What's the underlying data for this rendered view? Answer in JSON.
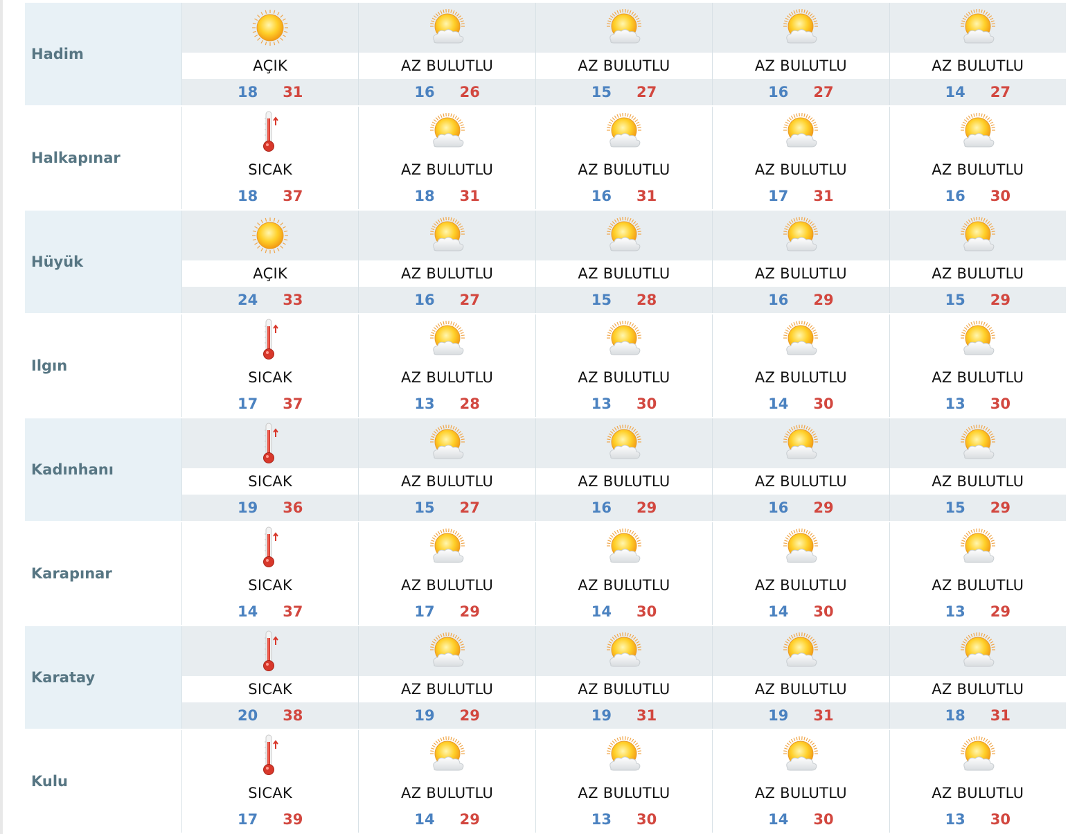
{
  "colors": {
    "low": "#4b82c0",
    "high": "#d2473f",
    "city": "#577683",
    "shade": "#e8f1f6"
  },
  "rows": [
    {
      "city": "Hadim",
      "days": [
        {
          "icon": "sun-icon",
          "desc": "AÇIK",
          "lo": "18",
          "hi": "31"
        },
        {
          "icon": "partly-cloudy-icon",
          "desc": "AZ BULUTLU",
          "lo": "16",
          "hi": "26"
        },
        {
          "icon": "partly-cloudy-icon",
          "desc": "AZ BULUTLU",
          "lo": "15",
          "hi": "27"
        },
        {
          "icon": "partly-cloudy-icon",
          "desc": "AZ BULUTLU",
          "lo": "16",
          "hi": "27"
        },
        {
          "icon": "partly-cloudy-icon",
          "desc": "AZ BULUTLU",
          "lo": "14",
          "hi": "27"
        }
      ]
    },
    {
      "city": "Halkapınar",
      "days": [
        {
          "icon": "thermometer-icon",
          "desc": "SICAK",
          "lo": "18",
          "hi": "37"
        },
        {
          "icon": "partly-cloudy-icon",
          "desc": "AZ BULUTLU",
          "lo": "18",
          "hi": "31"
        },
        {
          "icon": "partly-cloudy-icon",
          "desc": "AZ BULUTLU",
          "lo": "16",
          "hi": "31"
        },
        {
          "icon": "partly-cloudy-icon",
          "desc": "AZ BULUTLU",
          "lo": "17",
          "hi": "31"
        },
        {
          "icon": "partly-cloudy-icon",
          "desc": "AZ BULUTLU",
          "lo": "16",
          "hi": "30"
        }
      ]
    },
    {
      "city": "Hüyük",
      "days": [
        {
          "icon": "sun-icon",
          "desc": "AÇIK",
          "lo": "24",
          "hi": "33"
        },
        {
          "icon": "partly-cloudy-icon",
          "desc": "AZ BULUTLU",
          "lo": "16",
          "hi": "27"
        },
        {
          "icon": "partly-cloudy-icon",
          "desc": "AZ BULUTLU",
          "lo": "15",
          "hi": "28"
        },
        {
          "icon": "partly-cloudy-icon",
          "desc": "AZ BULUTLU",
          "lo": "16",
          "hi": "29"
        },
        {
          "icon": "partly-cloudy-icon",
          "desc": "AZ BULUTLU",
          "lo": "15",
          "hi": "29"
        }
      ]
    },
    {
      "city": "Ilgın",
      "days": [
        {
          "icon": "thermometer-icon",
          "desc": "SICAK",
          "lo": "17",
          "hi": "37"
        },
        {
          "icon": "partly-cloudy-icon",
          "desc": "AZ BULUTLU",
          "lo": "13",
          "hi": "28"
        },
        {
          "icon": "partly-cloudy-icon",
          "desc": "AZ BULUTLU",
          "lo": "13",
          "hi": "30"
        },
        {
          "icon": "partly-cloudy-icon",
          "desc": "AZ BULUTLU",
          "lo": "14",
          "hi": "30"
        },
        {
          "icon": "partly-cloudy-icon",
          "desc": "AZ BULUTLU",
          "lo": "13",
          "hi": "30"
        }
      ]
    },
    {
      "city": "Kadınhanı",
      "days": [
        {
          "icon": "thermometer-icon",
          "desc": "SICAK",
          "lo": "19",
          "hi": "36"
        },
        {
          "icon": "partly-cloudy-icon",
          "desc": "AZ BULUTLU",
          "lo": "15",
          "hi": "27"
        },
        {
          "icon": "partly-cloudy-icon",
          "desc": "AZ BULUTLU",
          "lo": "16",
          "hi": "29"
        },
        {
          "icon": "partly-cloudy-icon",
          "desc": "AZ BULUTLU",
          "lo": "16",
          "hi": "29"
        },
        {
          "icon": "partly-cloudy-icon",
          "desc": "AZ BULUTLU",
          "lo": "15",
          "hi": "29"
        }
      ]
    },
    {
      "city": "Karapınar",
      "days": [
        {
          "icon": "thermometer-icon",
          "desc": "SICAK",
          "lo": "14",
          "hi": "37"
        },
        {
          "icon": "partly-cloudy-icon",
          "desc": "AZ BULUTLU",
          "lo": "17",
          "hi": "29"
        },
        {
          "icon": "partly-cloudy-icon",
          "desc": "AZ BULUTLU",
          "lo": "14",
          "hi": "30"
        },
        {
          "icon": "partly-cloudy-icon",
          "desc": "AZ BULUTLU",
          "lo": "14",
          "hi": "30"
        },
        {
          "icon": "partly-cloudy-icon",
          "desc": "AZ BULUTLU",
          "lo": "13",
          "hi": "29"
        }
      ]
    },
    {
      "city": "Karatay",
      "days": [
        {
          "icon": "thermometer-icon",
          "desc": "SICAK",
          "lo": "20",
          "hi": "38"
        },
        {
          "icon": "partly-cloudy-icon",
          "desc": "AZ BULUTLU",
          "lo": "19",
          "hi": "29"
        },
        {
          "icon": "partly-cloudy-icon",
          "desc": "AZ BULUTLU",
          "lo": "19",
          "hi": "31"
        },
        {
          "icon": "partly-cloudy-icon",
          "desc": "AZ BULUTLU",
          "lo": "19",
          "hi": "31"
        },
        {
          "icon": "partly-cloudy-icon",
          "desc": "AZ BULUTLU",
          "lo": "18",
          "hi": "31"
        }
      ]
    },
    {
      "city": "Kulu",
      "days": [
        {
          "icon": "thermometer-icon",
          "desc": "SICAK",
          "lo": "17",
          "hi": "39"
        },
        {
          "icon": "partly-cloudy-icon",
          "desc": "AZ BULUTLU",
          "lo": "14",
          "hi": "29"
        },
        {
          "icon": "partly-cloudy-icon",
          "desc": "AZ BULUTLU",
          "lo": "13",
          "hi": "30"
        },
        {
          "icon": "partly-cloudy-icon",
          "desc": "AZ BULUTLU",
          "lo": "14",
          "hi": "30"
        },
        {
          "icon": "partly-cloudy-icon",
          "desc": "AZ BULUTLU",
          "lo": "13",
          "hi": "30"
        }
      ]
    }
  ]
}
